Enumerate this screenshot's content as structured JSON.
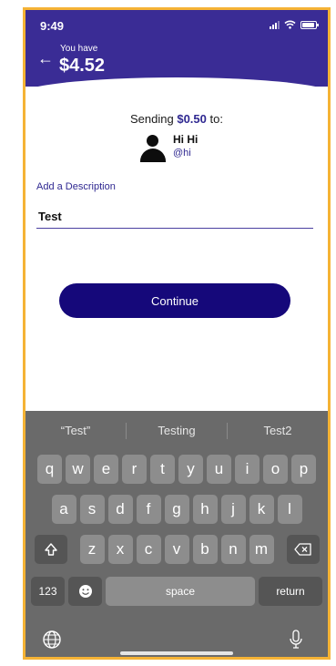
{
  "status": {
    "time": "9:49"
  },
  "header": {
    "caption": "You have",
    "balance": "$4.52"
  },
  "transfer": {
    "sending_prefix": "Sending ",
    "amount": "$0.50",
    "sending_suffix": " to:",
    "recipient_name": "Hi Hi",
    "recipient_handle": "@hi"
  },
  "description": {
    "label": "Add a Description",
    "value": "Test"
  },
  "actions": {
    "continue_label": "Continue"
  },
  "keyboard": {
    "suggestions": [
      "“Test”",
      "Testing",
      "Test2"
    ],
    "row1": [
      "q",
      "w",
      "e",
      "r",
      "t",
      "y",
      "u",
      "i",
      "o",
      "p"
    ],
    "row2": [
      "a",
      "s",
      "d",
      "f",
      "g",
      "h",
      "j",
      "k",
      "l"
    ],
    "row3": [
      "z",
      "x",
      "c",
      "v",
      "b",
      "n",
      "m"
    ],
    "numbers_label": "123",
    "space_label": "space",
    "return_label": "return"
  },
  "colors": {
    "header_bg": "#3a2c95",
    "accent": "#2f2891",
    "button_bg": "#15087a",
    "frame": "#f5b335"
  }
}
